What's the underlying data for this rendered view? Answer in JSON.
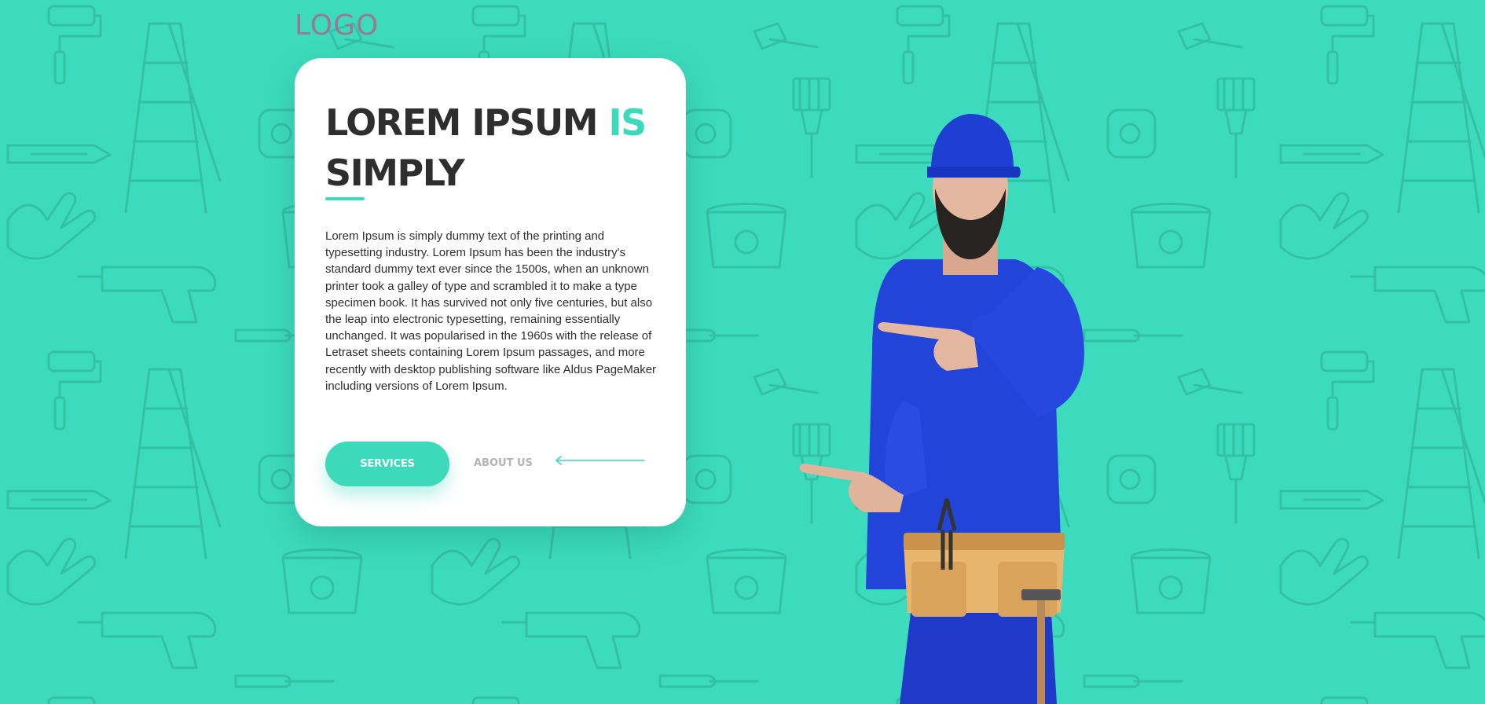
{
  "header": {
    "logo_text": "LOGO"
  },
  "hero": {
    "headline_part1": "LOREM IPSUM ",
    "headline_accent": "IS",
    "headline_part2": "SIMPLY",
    "body": "Lorem Ipsum is simply dummy text of the printing and typesetting industry. Lorem Ipsum has been the industry's standard dummy text ever since the 1500s, when an unknown printer took a galley of type and scrambled it to make a type specimen book. It has survived not only five centuries, but also the leap into electronic typesetting, remaining essentially unchanged. It was popularised in the 1960s with the release of Letraset sheets containing Lorem Ipsum passages, and more recently with desktop publishing software like Aldus PageMaker including versions of Lorem Ipsum.",
    "services_label": "SERVICES",
    "about_label": "ABOUT US"
  },
  "colors": {
    "background": "#3cdbbd",
    "accent": "#3dd9bb",
    "heading": "#2e2e2e",
    "logo": "#9a7a8e",
    "muted": "#b4b4b4"
  },
  "icons": {
    "arrow": "arrow-left-icon",
    "pattern": "tools-pattern"
  }
}
